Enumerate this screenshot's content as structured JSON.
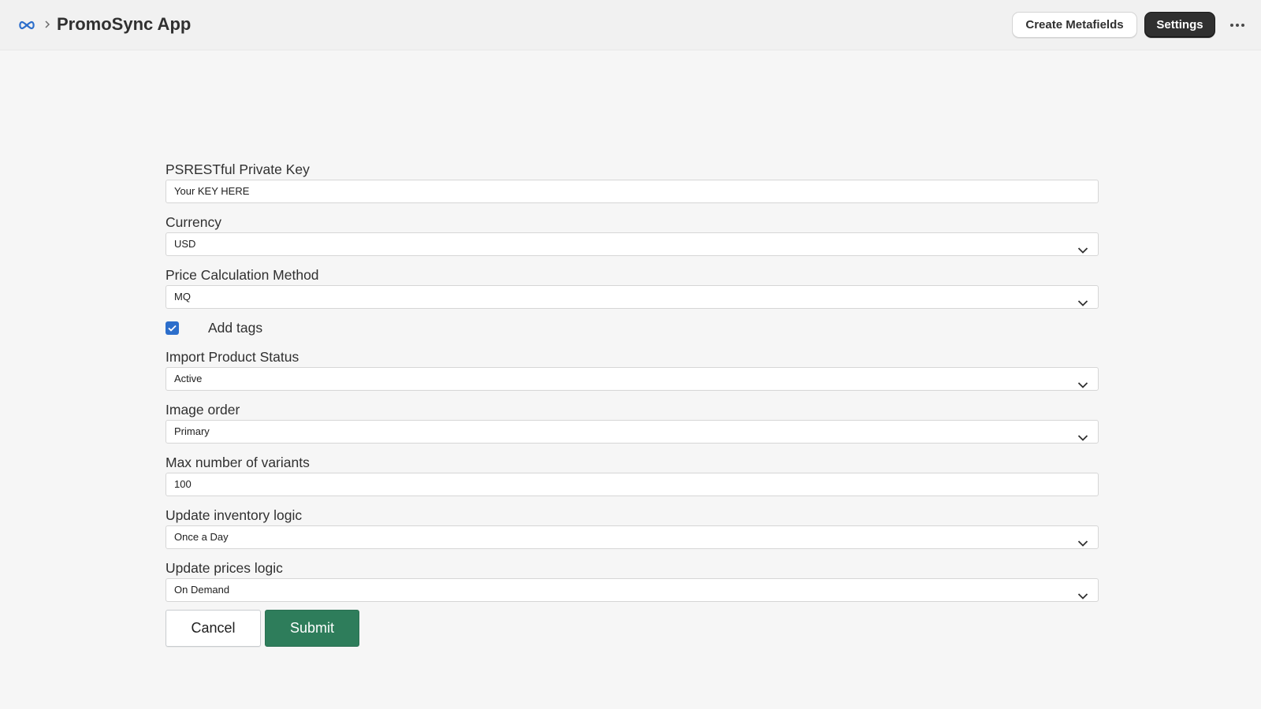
{
  "header": {
    "logo_icon": "infinity-icon",
    "breadcrumb_separator_icon": "chevron-right-icon",
    "title": "PromoSync App",
    "create_metafields_label": "Create Metafields",
    "settings_label": "Settings",
    "more_icon": "ellipsis-horizontal-icon"
  },
  "form": {
    "private_key": {
      "label": "PSRESTful Private Key",
      "value": "Your KEY HERE"
    },
    "currency": {
      "label": "Currency",
      "value": "USD"
    },
    "price_calculation_method": {
      "label": "Price Calculation Method",
      "value": "MQ"
    },
    "add_tags": {
      "label": "Add tags",
      "checked": true
    },
    "import_product_status": {
      "label": "Import Product Status",
      "value": "Active"
    },
    "image_order": {
      "label": "Image order",
      "value": "Primary"
    },
    "max_variants": {
      "label": "Max number of variants",
      "value": "100"
    },
    "update_inventory_logic": {
      "label": "Update inventory logic",
      "value": "Once a Day"
    },
    "update_prices_logic": {
      "label": "Update prices logic",
      "value": "On Demand"
    },
    "cancel_label": "Cancel",
    "submit_label": "Submit"
  },
  "colors": {
    "accent_primary": "#2e7d5b",
    "checkbox": "#2c6ecb",
    "settings_button": "#303030",
    "logo": "#2c6ecb"
  }
}
